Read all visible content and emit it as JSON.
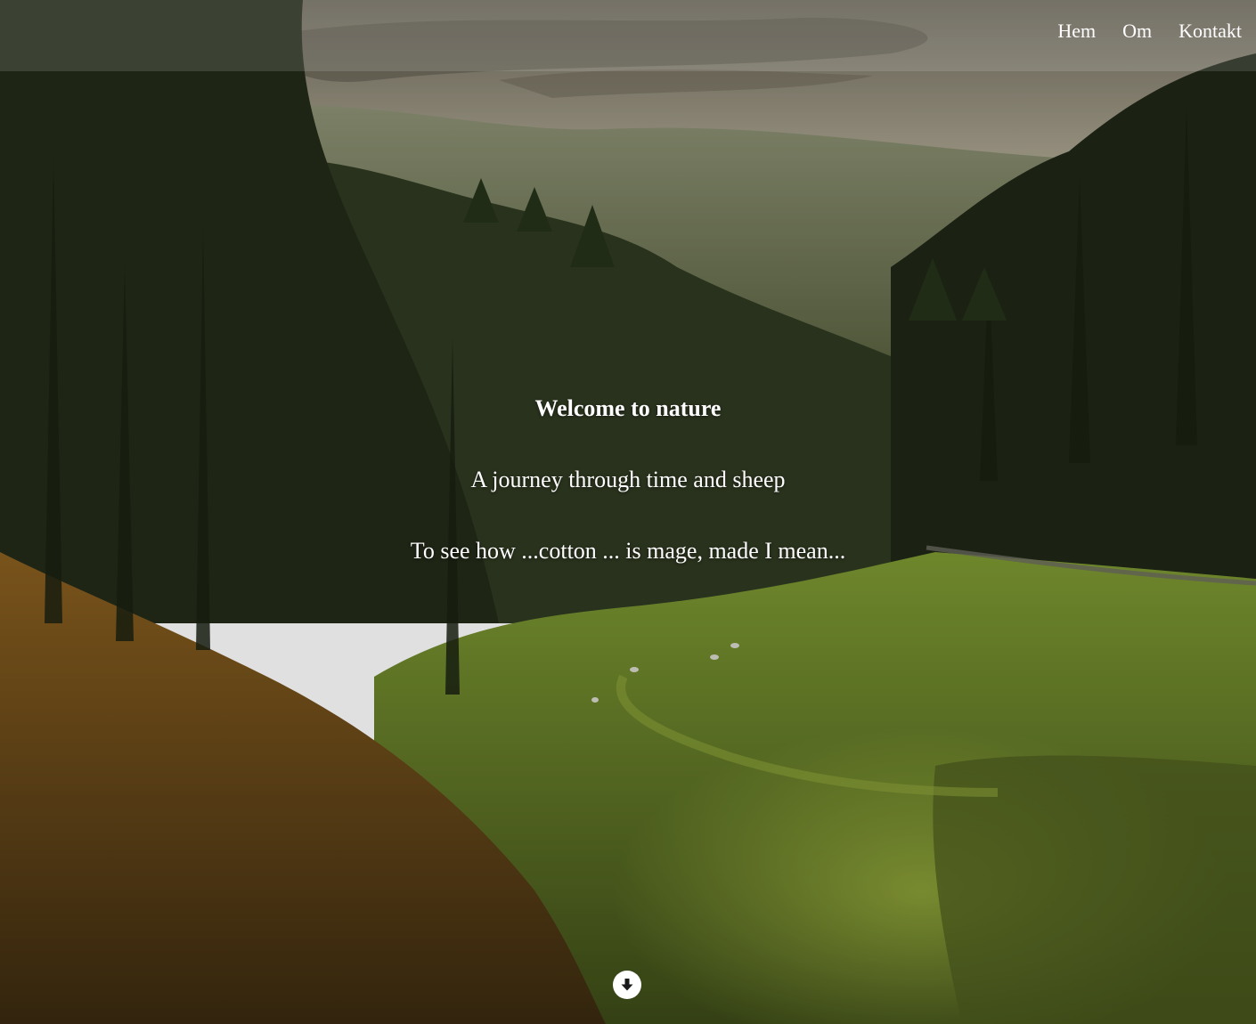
{
  "nav": {
    "items": [
      {
        "label": "Hem"
      },
      {
        "label": "Om"
      },
      {
        "label": "Kontakt"
      }
    ]
  },
  "hero": {
    "title": "Welcome to nature",
    "subtitle": "A journey through time and sheep",
    "tagline": "To see how ...cotton ... is mage, made I mean..."
  },
  "scroll_button": {
    "icon": "arrow-down-circle-icon"
  },
  "colors": {
    "text": "#ffffff",
    "sky": "#9a9583",
    "forest_dark": "#1e2416",
    "meadow": "#6f8a2a",
    "autumn": "#9a6a22"
  }
}
